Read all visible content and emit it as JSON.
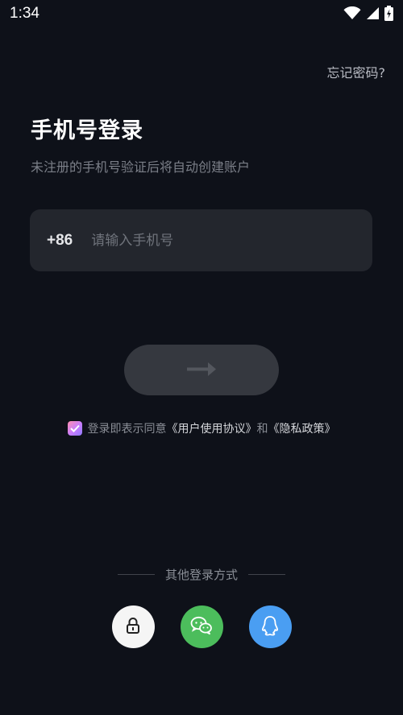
{
  "status_bar": {
    "time": "1:34",
    "icons": [
      "wifi-icon",
      "signal-icon",
      "battery-icon"
    ]
  },
  "header": {
    "forgot_password": "忘记密码?"
  },
  "main": {
    "title": "手机号登录",
    "subtitle": "未注册的手机号验证后将自动创建账户",
    "phone": {
      "country_code": "+86",
      "placeholder": "请输入手机号",
      "value": ""
    },
    "submit_icon": "arrow-right-icon"
  },
  "agreement": {
    "checked": true,
    "prefix": "登录即表示同意",
    "user_agreement": "《用户使用协议》",
    "conjunction": "和",
    "privacy_policy": "《隐私政策》"
  },
  "other_login": {
    "label": "其他登录方式",
    "options": [
      {
        "name": "password",
        "icon": "lock-icon",
        "color": "#f5f5f5"
      },
      {
        "name": "wechat",
        "icon": "wechat-icon",
        "color": "#4cbd5c"
      },
      {
        "name": "qq",
        "icon": "qq-icon",
        "color": "#4a9ef2"
      }
    ]
  },
  "colors": {
    "background": "#0e1119",
    "input_background": "#23262d",
    "button_disabled": "#35383f",
    "muted_text": "#7b7f88"
  }
}
